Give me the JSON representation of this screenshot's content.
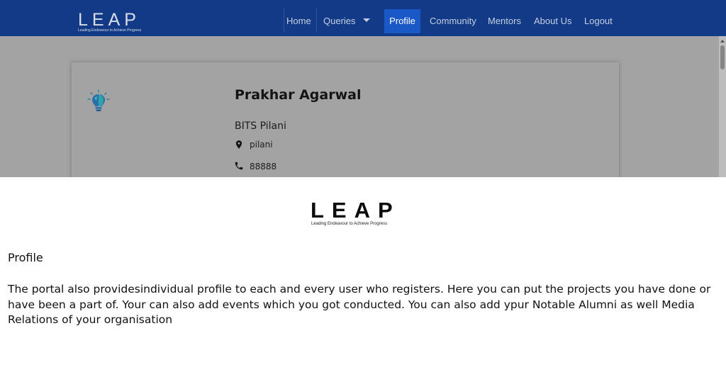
{
  "navbar": {
    "logo_text": "LEAP",
    "logo_tagline": "Leading Endeavour to Achieve Progress",
    "items": [
      "Home",
      "Queries",
      "Profile",
      "Community",
      "Mentors",
      "About Us",
      "Logout"
    ],
    "active_item": "Profile",
    "colors": {
      "background": "#123a86",
      "active": "#1a57c7"
    }
  },
  "profile": {
    "name": "Prakhar Agarwal",
    "institution": "BITS Pilani",
    "location": "pilani",
    "phone": "88888",
    "avatar_icon": "lightbulb-icon"
  },
  "promo": {
    "logo_text": "LEAP",
    "logo_tagline": "Leading Endeavour to Achieve Progress",
    "title": "Profile",
    "body": "The portal also providesindividual profile to each and every user who registers. Here you can put the projects you have done or have been a part of. Your can also add events which you got conducted. You can also add ypur Notable Alumni as well Media Relations of your organisation"
  }
}
